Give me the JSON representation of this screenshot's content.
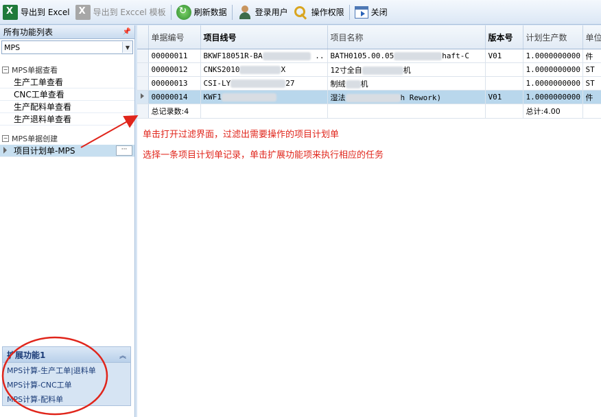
{
  "toolbar": {
    "export_excel": "导出到 Excel",
    "export_template": "导出到 Exccel 模板",
    "refresh": "刷新数据",
    "login_user": "登录用户",
    "permissions": "操作权限",
    "close": "关闭"
  },
  "left_panel": {
    "title": "所有功能列表",
    "module_select": "MPS",
    "group_query": {
      "title": "MPS单据查看",
      "items": [
        "生产工单查看",
        "CNC工单查看",
        "生产配料单查看",
        "生产退料单查看"
      ]
    },
    "group_create": {
      "title": "MPS单据创建",
      "items": [
        "项目计划单-MPS"
      ]
    },
    "more_button": "···"
  },
  "ext_panel": {
    "title": "扩展功能1",
    "links": [
      "MPS计算-生产工单|退料单",
      "MPS计算-CNC工单",
      "MPS计算-配料单"
    ]
  },
  "grid": {
    "columns": [
      "单据编号",
      "项目线号",
      "项目名称",
      "版本号",
      "计划生产数",
      "单位"
    ],
    "rows": [
      {
        "id": "00000011",
        "line": "BKWF18051R-BA",
        "name_start": "BATH0105.00.05",
        "name_end": "haft-C",
        "version": "V01",
        "qty": "1.0000000000",
        "unit": "件"
      },
      {
        "id": "00000012",
        "line": "CNKS2010",
        "line_end": "X",
        "name_start": "12寸全自",
        "name_end": "机",
        "version": "",
        "qty": "1.0000000000",
        "unit": "ST"
      },
      {
        "id": "00000013",
        "line": "CSI-LY",
        "line_end": "27",
        "name_start": "制绒",
        "name_end": "机",
        "version": "",
        "qty": "1.0000000000",
        "unit": "ST"
      },
      {
        "id": "00000014",
        "line": "KWF1",
        "name_start": "湿法",
        "name_end": "h Rework)",
        "version": "V01",
        "qty": "1.0000000000",
        "unit": "件"
      }
    ],
    "footer": {
      "count": "总记录数:4",
      "total": "总计:4.00"
    }
  },
  "annotations": {
    "line1": "单击打开过滤界面，过滤出需要操作的项目计划单",
    "line2": "选择一条项目计划单记录，单击扩展功能项来执行相应的任务",
    "color": "#e0251b"
  }
}
